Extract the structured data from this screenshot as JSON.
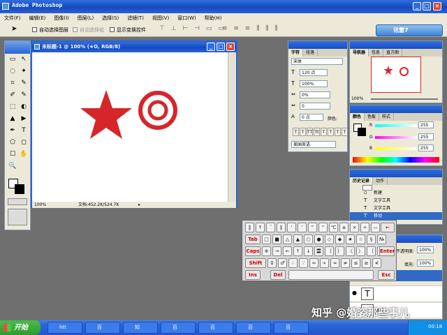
{
  "app": {
    "title": "Adobe Photoshop"
  },
  "menu": [
    "文件(F)",
    "编辑(E)",
    "图像(I)",
    "图层(L)",
    "选择(S)",
    "滤镜(T)",
    "视图(V)",
    "窗口(W)",
    "帮助(H)"
  ],
  "options": {
    "auto_select": "自动选择图层",
    "auto_align": "自动选择组",
    "show_transform": "显示变换控件"
  },
  "brand": {
    "text": "讯雷7"
  },
  "document": {
    "title": "未标题-1 @ 100% (★O, RGB/8)",
    "zoom": "100%",
    "doc_info": "文档:452.2K/524.7K"
  },
  "character": {
    "tabs": [
      "字符",
      "段落"
    ],
    "font": "宋体",
    "size": "120 点",
    "scale": "100%",
    "tracking_a": "0%",
    "tracking_b": "0",
    "baseline": "0 点",
    "color_label": "颜色:",
    "language": "美国英语"
  },
  "navigator": {
    "tabs": [
      "导航器",
      "信息",
      "直方图"
    ],
    "zoom": "100%"
  },
  "color": {
    "tabs": [
      "颜色",
      "色板",
      "样式"
    ],
    "r_label": "R",
    "g_label": "G",
    "b_label": "B",
    "r": "255",
    "g": "255",
    "b": "255"
  },
  "history": {
    "tabs": [
      "历史记录",
      "动作"
    ],
    "items": [
      "新建",
      "文字工具",
      "文字工具",
      "移动"
    ]
  },
  "layers": {
    "opacity_label": "不透明度:",
    "opacity": "100%",
    "fill_label": "填充:",
    "fill": "100%",
    "layer_name": "图层"
  },
  "keyboard": {
    "tab": "Tab",
    "caps": "Caps",
    "shift": "Shift",
    "enter": "Enter",
    "ins": "Ins",
    "del": "Del",
    "esc": "Esc"
  },
  "taskbar": {
    "start": "开始",
    "items": [
      "htt",
      "百",
      "知",
      "百",
      "百",
      "百",
      "百"
    ],
    "clock": "00:18"
  },
  "watermark": "知乎 @婚姿那些事儿",
  "colors": {
    "accent": "#d6262a"
  }
}
